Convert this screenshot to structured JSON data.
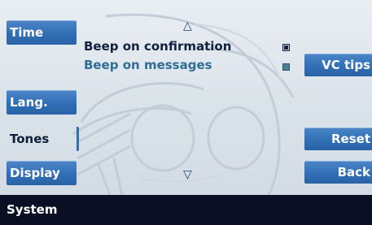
{
  "left_tabs": [
    {
      "label": "Time"
    },
    {
      "label": "Lang."
    },
    {
      "label": "Tones"
    },
    {
      "label": "Display"
    }
  ],
  "options": [
    {
      "label": "Beep on confirmation",
      "checked": true
    },
    {
      "label": "Beep on messages",
      "checked": false
    }
  ],
  "right_buttons": {
    "vc_tips": "VC tips",
    "reset": "Reset",
    "back": "Back"
  },
  "status_bar": {
    "title": "System"
  },
  "icons": {
    "scroll_up": "scroll-up-arrow-icon",
    "scroll_down": "scroll-down-arrow-icon"
  },
  "colors": {
    "accent": "#2f6db4",
    "status_bar": "#0a0f24",
    "background": "#dde5ec"
  }
}
